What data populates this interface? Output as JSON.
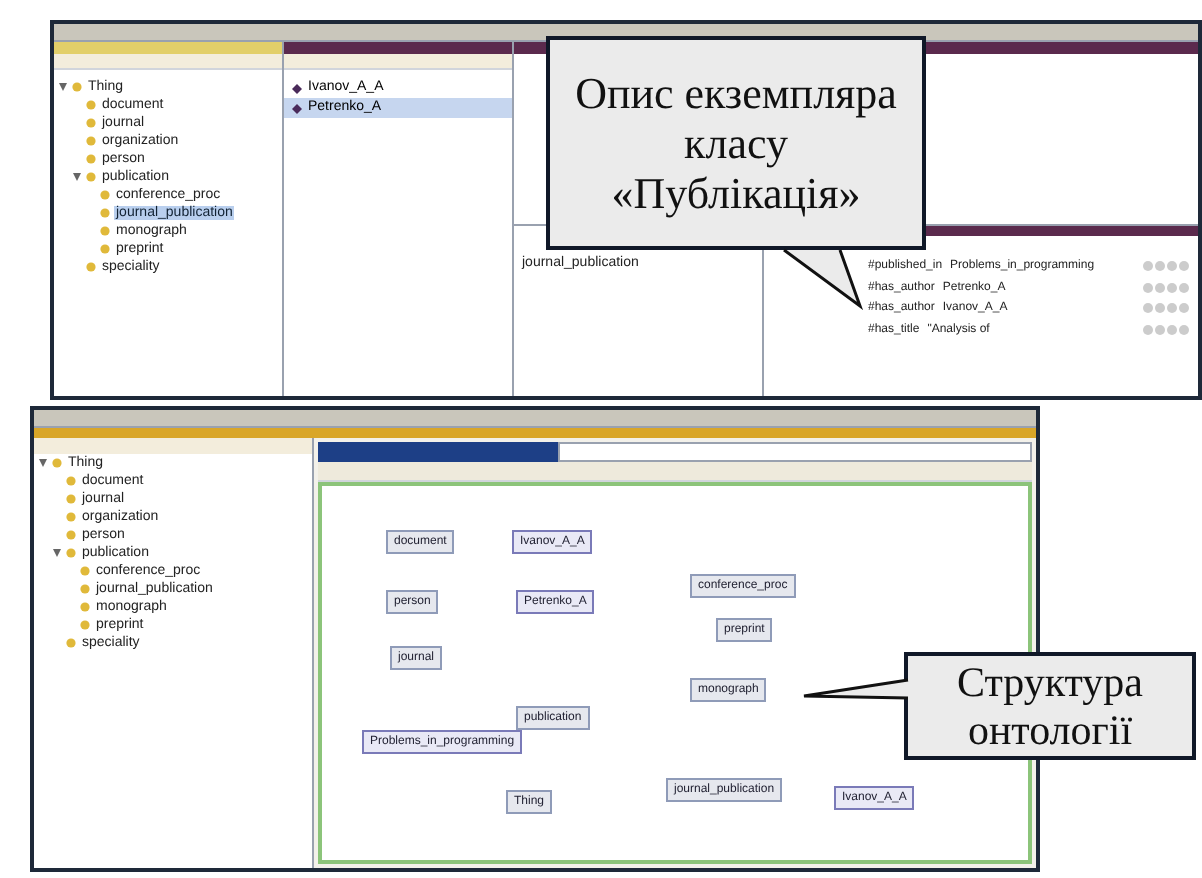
{
  "top_window": {
    "class_tree": [
      {
        "label": "Thing",
        "expanded": true,
        "children": [
          {
            "label": "document"
          },
          {
            "label": "journal"
          },
          {
            "label": "organization"
          },
          {
            "label": "person"
          },
          {
            "label": "publication",
            "expanded": true,
            "children": [
              {
                "label": "conference_proc"
              },
              {
                "label": "journal_publication",
                "selected": true
              },
              {
                "label": "monograph"
              },
              {
                "label": "preprint"
              }
            ]
          },
          {
            "label": "speciality"
          }
        ]
      }
    ],
    "instances": [
      {
        "label": "Ivanov_A_A",
        "selected": false
      },
      {
        "label": "Petrenko_A",
        "selected": true
      }
    ],
    "types": [
      "journal_publication"
    ],
    "assertions": [
      {
        "property": "#published_in",
        "value": "Problems_in_programming"
      },
      {
        "property": "#has_author",
        "value": "Petrenko_A"
      },
      {
        "property": "#has_author",
        "value": "Ivanov_A_A"
      },
      {
        "property": "#has_title",
        "value": "\"Analysis of"
      }
    ]
  },
  "bottom_window": {
    "class_tree": [
      {
        "label": "Thing",
        "expanded": true,
        "children": [
          {
            "label": "document"
          },
          {
            "label": "journal"
          },
          {
            "label": "organization"
          },
          {
            "label": "person"
          },
          {
            "label": "publication",
            "expanded": true,
            "children": [
              {
                "label": "conference_proc"
              },
              {
                "label": "journal_publication"
              },
              {
                "label": "monograph"
              },
              {
                "label": "preprint"
              }
            ]
          },
          {
            "label": "speciality"
          }
        ]
      }
    ],
    "graph_nodes": [
      {
        "label": "document",
        "kind": "class"
      },
      {
        "label": "Ivanov_A_A",
        "kind": "individual"
      },
      {
        "label": "person",
        "kind": "class"
      },
      {
        "label": "Petrenko_A",
        "kind": "individual"
      },
      {
        "label": "journal",
        "kind": "class"
      },
      {
        "label": "publication",
        "kind": "class"
      },
      {
        "label": "Problems_in_programming",
        "kind": "individual"
      },
      {
        "label": "Thing",
        "kind": "class"
      },
      {
        "label": "conference_proc",
        "kind": "class"
      },
      {
        "label": "preprint",
        "kind": "class"
      },
      {
        "label": "monograph",
        "kind": "class"
      },
      {
        "label": "journal_publication",
        "kind": "class"
      },
      {
        "label": "Ivanov_A_A",
        "kind": "individual"
      }
    ]
  },
  "callouts": [
    {
      "text": "Опис екземпляра класу «Публікація»"
    },
    {
      "text": "Структура онтології"
    }
  ]
}
